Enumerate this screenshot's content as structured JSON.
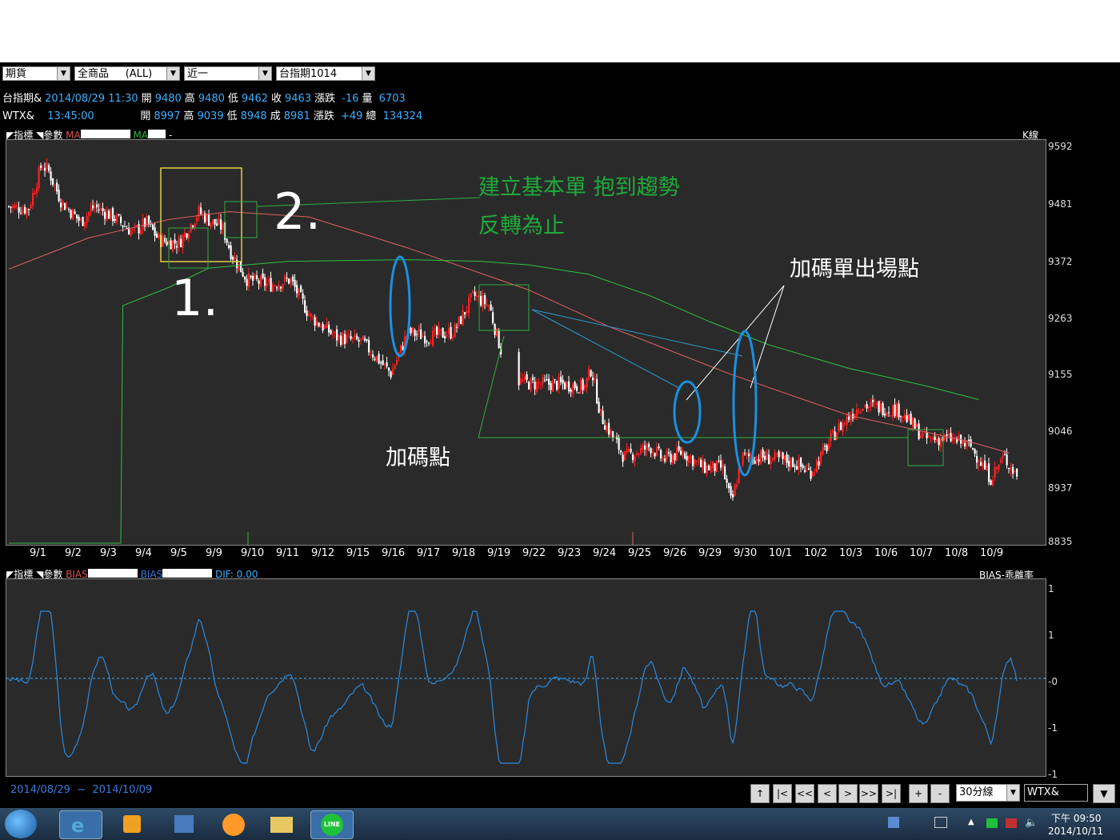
{
  "toolbar": {
    "market": "期貨",
    "product": "全商品",
    "product_all": "(ALL)",
    "period": "近一",
    "contract": "台指期1014"
  },
  "info_row1": {
    "name": "台指期&",
    "datetime": "2014/08/29 11:30",
    "open_label": "開",
    "open": "9480",
    "high_label": "高",
    "high": "9480",
    "low_label": "低",
    "low": "9462",
    "close_label": "收",
    "close": "9463",
    "change_label": "漲跌",
    "change": "-16",
    "vol_label": "量",
    "vol": "6703"
  },
  "info_row2": {
    "name": "WTX&",
    "time": "13:45:00",
    "open_label": "開",
    "open": "8997",
    "high_label": "高",
    "high": "9039",
    "low_label": "低",
    "low": "8948",
    "close_label": "成",
    "close": "8981",
    "change_label": "漲跌",
    "change": "+49",
    "vol_label": "總",
    "vol": "134324"
  },
  "main_header": {
    "indicator": "指標",
    "params": "參數",
    "ma1": "MA",
    "ma2": "MA",
    "dash": "-",
    "type": "K線"
  },
  "sub_header": {
    "indicator": "指標",
    "params": "參數",
    "bias1": "BIAS",
    "bias2": "BIAS",
    "dif": "DIF:",
    "dif_value": "0.00",
    "type": "BIAS-乖離率"
  },
  "chart_data": {
    "type": "candlestick",
    "x_labels": [
      "9/1",
      "9/2",
      "9/3",
      "9/4",
      "9/5",
      "9/9",
      "9/10",
      "9/11",
      "9/12",
      "9/15",
      "9/16",
      "9/17",
      "9/18",
      "9/19",
      "9/22",
      "9/23",
      "9/24",
      "9/25",
      "9/26",
      "9/29",
      "9/30",
      "10/1",
      "10/2",
      "10/3",
      "10/6",
      "10/7",
      "10/8",
      "10/9"
    ],
    "y_ticks": [
      "9592",
      "9481",
      "9372",
      "9263",
      "9155",
      "9046",
      "8937",
      "8835"
    ],
    "ylim": [
      8835,
      9592
    ],
    "bias_ticks": [
      "1",
      "1",
      "-0",
      "-1",
      "-1"
    ],
    "ma_long": [
      [
        0,
        8835
      ],
      [
        56,
        8835
      ],
      [
        57,
        9290
      ],
      [
        80,
        9325
      ],
      [
        100,
        9362
      ],
      [
        140,
        9375
      ],
      [
        200,
        9378
      ],
      [
        236,
        9375
      ],
      [
        260,
        9368
      ],
      [
        290,
        9350
      ],
      [
        320,
        9310
      ],
      [
        350,
        9260
      ],
      [
        380,
        9215
      ],
      [
        420,
        9170
      ],
      [
        460,
        9135
      ],
      [
        485,
        9110
      ]
    ],
    "ma_short": [
      [
        0,
        9360
      ],
      [
        40,
        9420
      ],
      [
        80,
        9455
      ],
      [
        110,
        9470
      ],
      [
        150,
        9460
      ],
      [
        200,
        9400
      ],
      [
        260,
        9320
      ],
      [
        300,
        9250
      ],
      [
        360,
        9160
      ],
      [
        420,
        9080
      ],
      [
        480,
        9030
      ],
      [
        500,
        9008
      ]
    ]
  },
  "annotations": {
    "a1": "建立基本單 抱到趨勢",
    "a2": "反轉為止",
    "exit": "加碼單出場點",
    "add": "加碼點",
    "n1": "1.",
    "n2": "2."
  },
  "footer": {
    "range_start": "2014/08/29",
    "tilde": "~",
    "range_end": "2014/10/09",
    "period_select": "30分線",
    "symbol_input": "WTX&"
  },
  "nav_buttons": [
    "|<",
    "<<",
    "<",
    ">",
    ">>",
    ">|",
    "+",
    "-"
  ],
  "nav_up": "↑",
  "taskbar": {
    "time": "下午 09:50",
    "date": "2014/10/11",
    "line_label": "LINE"
  }
}
